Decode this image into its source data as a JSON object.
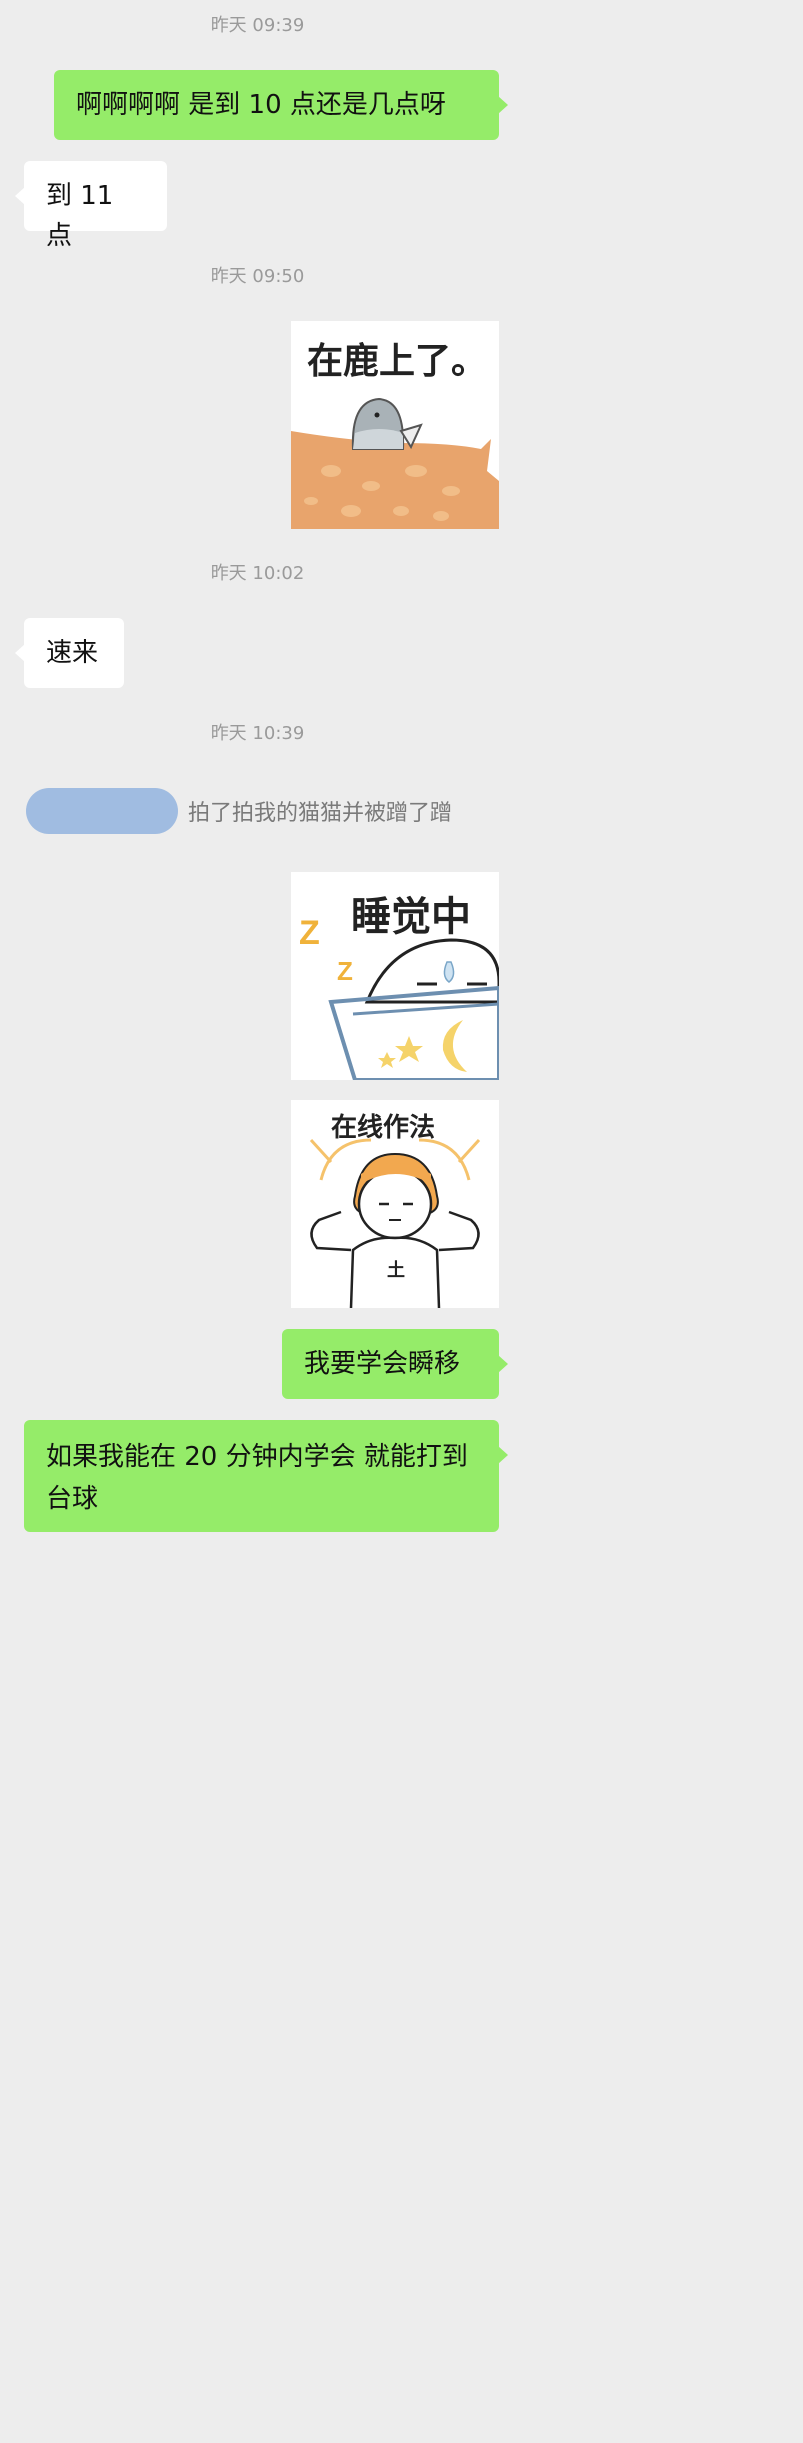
{
  "messages": {
    "ts1": "昨天 09:39",
    "m1": "啊啊啊啊 是到 10 点还是几点呀",
    "m2": "到 11 点",
    "ts2": "昨天 09:50",
    "sticker1_text": "在鹿上了。",
    "ts3": "昨天 10:02",
    "m3": "速来",
    "ts4": "昨天 10:39",
    "system_pat": "拍了拍我的猫猫并被蹭了蹭",
    "sticker2_text": "睡觉中",
    "sticker3_text": "在线作法",
    "m4": "我要学会瞬移",
    "m5": "如果我能在 20 分钟内学会 就能打到台球"
  },
  "colors": {
    "background": "#ededed",
    "self_bubble": "#95ec69",
    "other_bubble": "#ffffff",
    "timestamp": "#9a9a9a"
  }
}
